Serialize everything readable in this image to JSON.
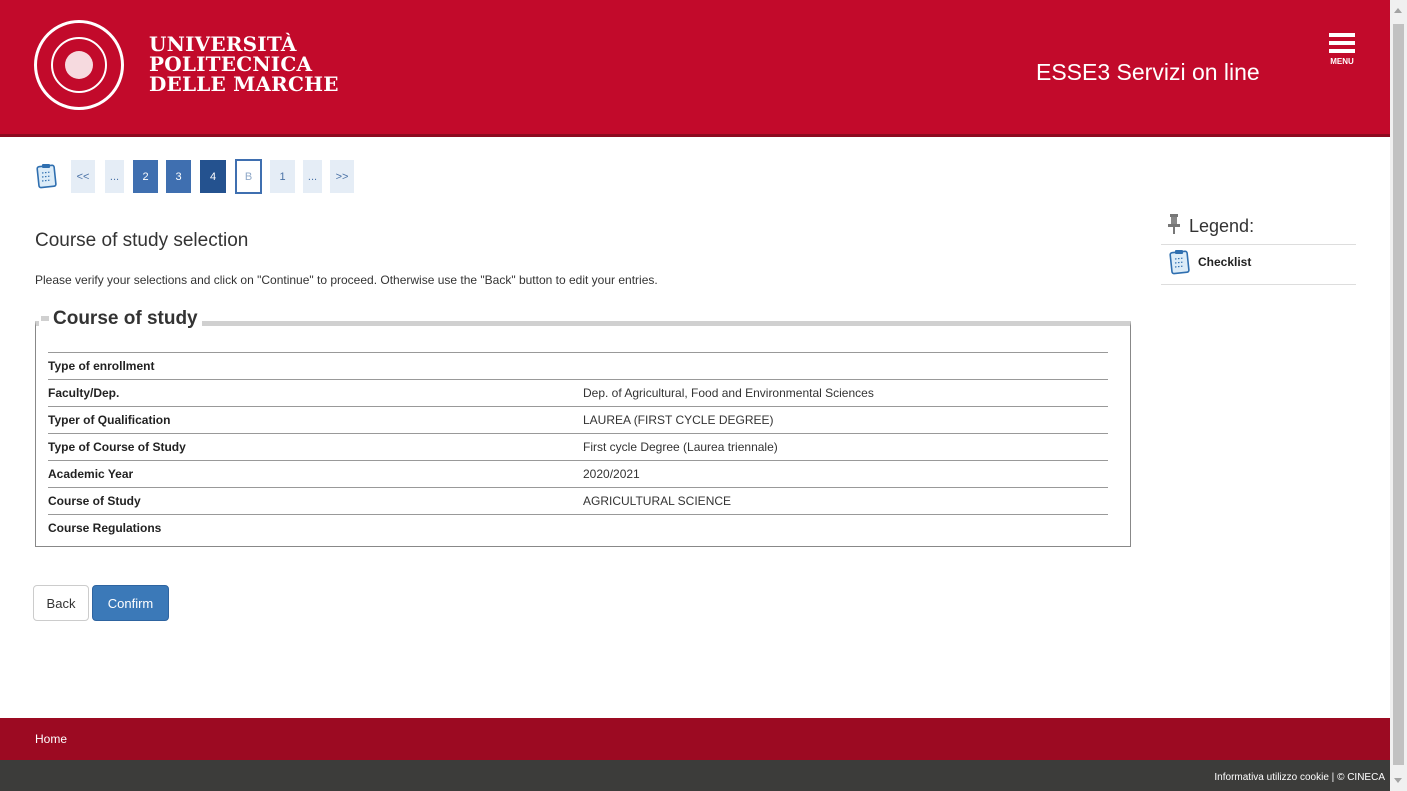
{
  "header": {
    "university_line1": "UNIVERSITÀ",
    "university_line2": "POLITECNICA",
    "university_line3": "DELLE MARCHE",
    "app_title": "ESSE3 Servizi on line",
    "menu_label": "MENU"
  },
  "pager": {
    "first": "<<",
    "ellipsis_left": "...",
    "step_2": "2",
    "step_3": "3",
    "step_4": "4",
    "step_current": "B",
    "step_1": "1",
    "ellipsis_right": "...",
    "last": ">>"
  },
  "main": {
    "title": "Course of study selection",
    "instructions": "Please verify your selections and click on \"Continue\" to proceed. Otherwise use the \"Back\" button to edit your entries.",
    "section_title": "Course of study",
    "rows": [
      {
        "label": "Type of enrollment",
        "value": ""
      },
      {
        "label": "Faculty/Dep.",
        "value": "Dep. of Agricultural, Food and Environmental Sciences"
      },
      {
        "label": "Typer of Qualification",
        "value": "LAUREA (FIRST CYCLE DEGREE)"
      },
      {
        "label": "Type of Course of Study",
        "value": "First cycle Degree (Laurea triennale)"
      },
      {
        "label": "Academic Year",
        "value": "2020/2021"
      },
      {
        "label": "Course of Study",
        "value": "AGRICULTURAL SCIENCE"
      },
      {
        "label": "Course Regulations",
        "value": ""
      }
    ],
    "back_label": "Back",
    "confirm_label": "Confirm"
  },
  "legend": {
    "title": "Legend:",
    "items": [
      {
        "label": "Checklist",
        "icon": "checklist-icon"
      }
    ]
  },
  "footer": {
    "home_link": "Home",
    "cookie_link": "Informativa utilizzo cookie",
    "separator": "|",
    "copyright": "© CINECA"
  },
  "colors": {
    "brand_red": "#c20a2b",
    "footer_red": "#9c0a22",
    "footer_dark": "#3c3c3a",
    "button_blue": "#3b79b8"
  }
}
